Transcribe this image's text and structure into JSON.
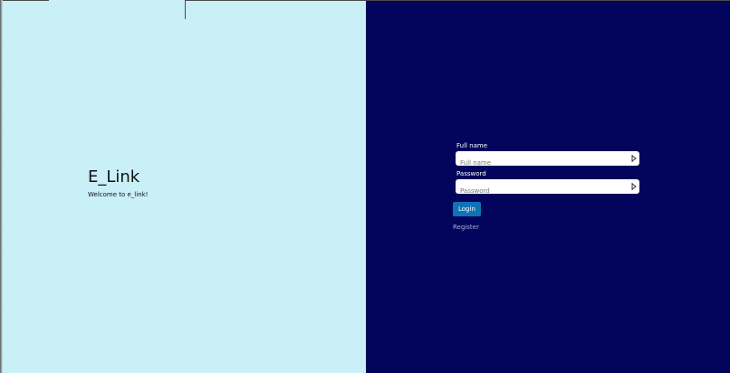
{
  "brand": {
    "title": "E_Link",
    "welcome": "Welcome to e_link!"
  },
  "login_form": {
    "full_name": {
      "label": "Full name",
      "placeholder": "Full name",
      "value": ""
    },
    "password": {
      "label": "Password",
      "placeholder": "Password",
      "value": ""
    },
    "login_label": "Login",
    "register_label": "Register"
  },
  "colors": {
    "left_background": "#c9eff7",
    "right_background": "#03045c",
    "button_background": "#0f73b6",
    "link_color": "#a9b6d8"
  },
  "icons": {
    "field_icon": "password-manager-icon"
  }
}
